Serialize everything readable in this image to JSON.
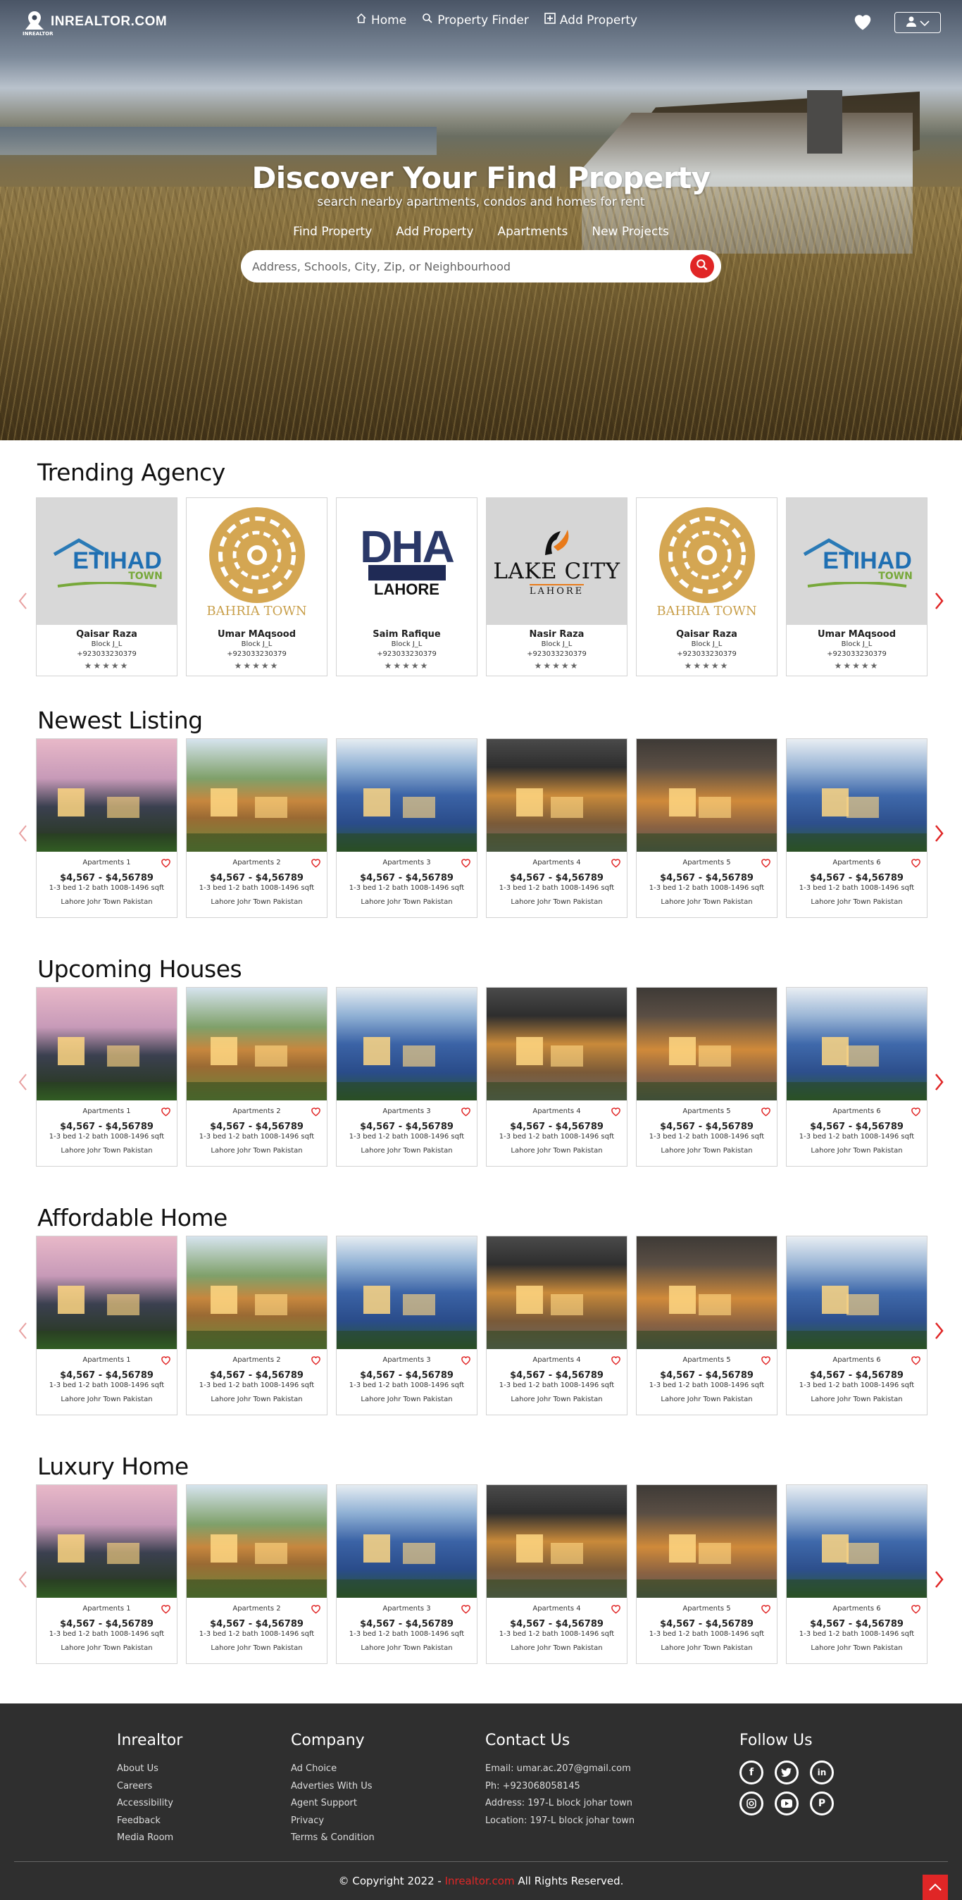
{
  "nav": {
    "brand": "INREALTOR.COM",
    "brand_sub": "INREALTOR",
    "menu": [
      {
        "label": "Home",
        "icon": "home-icon"
      },
      {
        "label": "Property Finder",
        "icon": "search-icon"
      },
      {
        "label": "Add Property",
        "icon": "plus-square-icon"
      }
    ]
  },
  "hero": {
    "title": "Discover Your Find Property",
    "subtitle": "search nearby apartments, condos and homes for rent",
    "links": [
      "Find Property",
      "Add Property",
      "Apartments",
      "New Projects"
    ],
    "search_placeholder": "Address, Schools, City, Zip, or Neighbourhood"
  },
  "agency_section": {
    "title": "Trending Agency",
    "items": [
      {
        "logo": "etihad",
        "logo_text": "ETIHAD",
        "logo_sub": "TOWN",
        "name": "Qaisar Raza",
        "block": "Block J_L",
        "phone": "+923033230379",
        "stars": "★★★★★"
      },
      {
        "logo": "bahria",
        "logo_text": "BAHRIA TOWN",
        "logo_sub": "",
        "name": "Umar MAqsood",
        "block": "Block J_L",
        "phone": "+923033230379",
        "stars": "★★★★★"
      },
      {
        "logo": "dha",
        "logo_text": "DHA",
        "logo_sub": "LAHORE",
        "name": "Saim Rafique",
        "block": "Block J_L",
        "phone": "+923033230379",
        "stars": "★★★★★"
      },
      {
        "logo": "lakecity",
        "logo_text": "LAKE CITY",
        "logo_sub": "LAHORE",
        "name": "Nasir Raza",
        "block": "Block J_L",
        "phone": "+923033230379",
        "stars": "★★★★★"
      },
      {
        "logo": "bahria",
        "logo_text": "BAHRIA TOWN",
        "logo_sub": "",
        "name": "Qaisar Raza",
        "block": "Block J_L",
        "phone": "+923033230379",
        "stars": "★★★★★"
      },
      {
        "logo": "etihad",
        "logo_text": "ETIHAD",
        "logo_sub": "TOWN",
        "name": "Umar MAqsood",
        "block": "Block J_L",
        "phone": "+923033230379",
        "stars": "★★★★★"
      }
    ]
  },
  "listings": [
    {
      "title": "Newest Listing"
    },
    {
      "title": "Upcoming Houses"
    },
    {
      "title": "Affordable Home"
    },
    {
      "title": "Luxury Home"
    }
  ],
  "property": {
    "items": [
      {
        "title": "Apartments 1",
        "style": "h1"
      },
      {
        "title": "Apartments 2",
        "style": "h2"
      },
      {
        "title": "Apartments 3",
        "style": "h3"
      },
      {
        "title": "Apartments 4",
        "style": "h4"
      },
      {
        "title": "Apartments 5",
        "style": "h5"
      },
      {
        "title": "Apartments 6",
        "style": "h6"
      }
    ],
    "price": "$4,567 - $4,56789",
    "beds": "1-3 bed 1-2 bath 1008-1496 sqft",
    "location": "Lahore Johr Town Pakistan"
  },
  "footer": {
    "inrealtor": {
      "title": "Inrealtor",
      "links": [
        "About Us",
        "Careers",
        "Accessibility",
        "Feedback",
        "Media Room"
      ]
    },
    "company": {
      "title": "Company",
      "links": [
        "Ad Choice",
        "Adverties With Us",
        "Agent Support",
        "Privacy",
        "Terms & Condition"
      ]
    },
    "contact": {
      "title": "Contact Us",
      "lines": [
        "Email: umar.ac.207@gmail.com",
        "Ph: +923068058145",
        "Address: 197-L block johar town",
        "Location: 197-L block johar town"
      ]
    },
    "follow": {
      "title": "Follow Us",
      "icons": [
        "facebook-icon",
        "twitter-icon",
        "linkedin-icon",
        "instagram-icon",
        "youtube-icon",
        "pinterest-icon"
      ]
    },
    "copy_prefix": "© Copyright 2022 - ",
    "copy_brand": "Inrealtor.com",
    "copy_suffix": " All Rights Reserved."
  },
  "colors": {
    "accent": "#e02626",
    "footer_bg": "#2f2f2f"
  }
}
